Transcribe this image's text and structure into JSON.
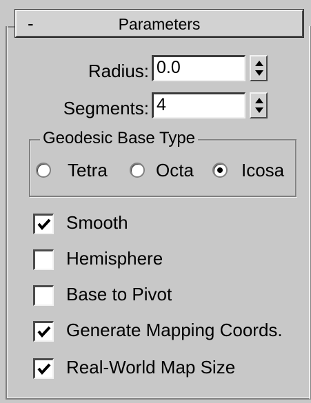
{
  "rollout": {
    "collapse_symbol": "-",
    "title": "Parameters"
  },
  "fields": {
    "radius_label": "Radius:",
    "radius_value": "0.0",
    "segments_label": "Segments:",
    "segments_value": "4"
  },
  "geodesic": {
    "title": "Geodesic Base Type",
    "options": [
      {
        "label": "Tetra",
        "selected": false
      },
      {
        "label": "Octa",
        "selected": false
      },
      {
        "label": "Icosa",
        "selected": true
      }
    ]
  },
  "options": [
    {
      "label": "Smooth",
      "checked": true
    },
    {
      "label": "Hemisphere",
      "checked": false
    },
    {
      "label": "Base to Pivot",
      "checked": false
    },
    {
      "label": "Generate Mapping Coords.",
      "checked": true
    },
    {
      "label": "Real-World Map Size",
      "checked": true
    }
  ],
  "icons": {
    "spinner": "spinner-arrows-icon",
    "check": "checkmark-icon"
  }
}
